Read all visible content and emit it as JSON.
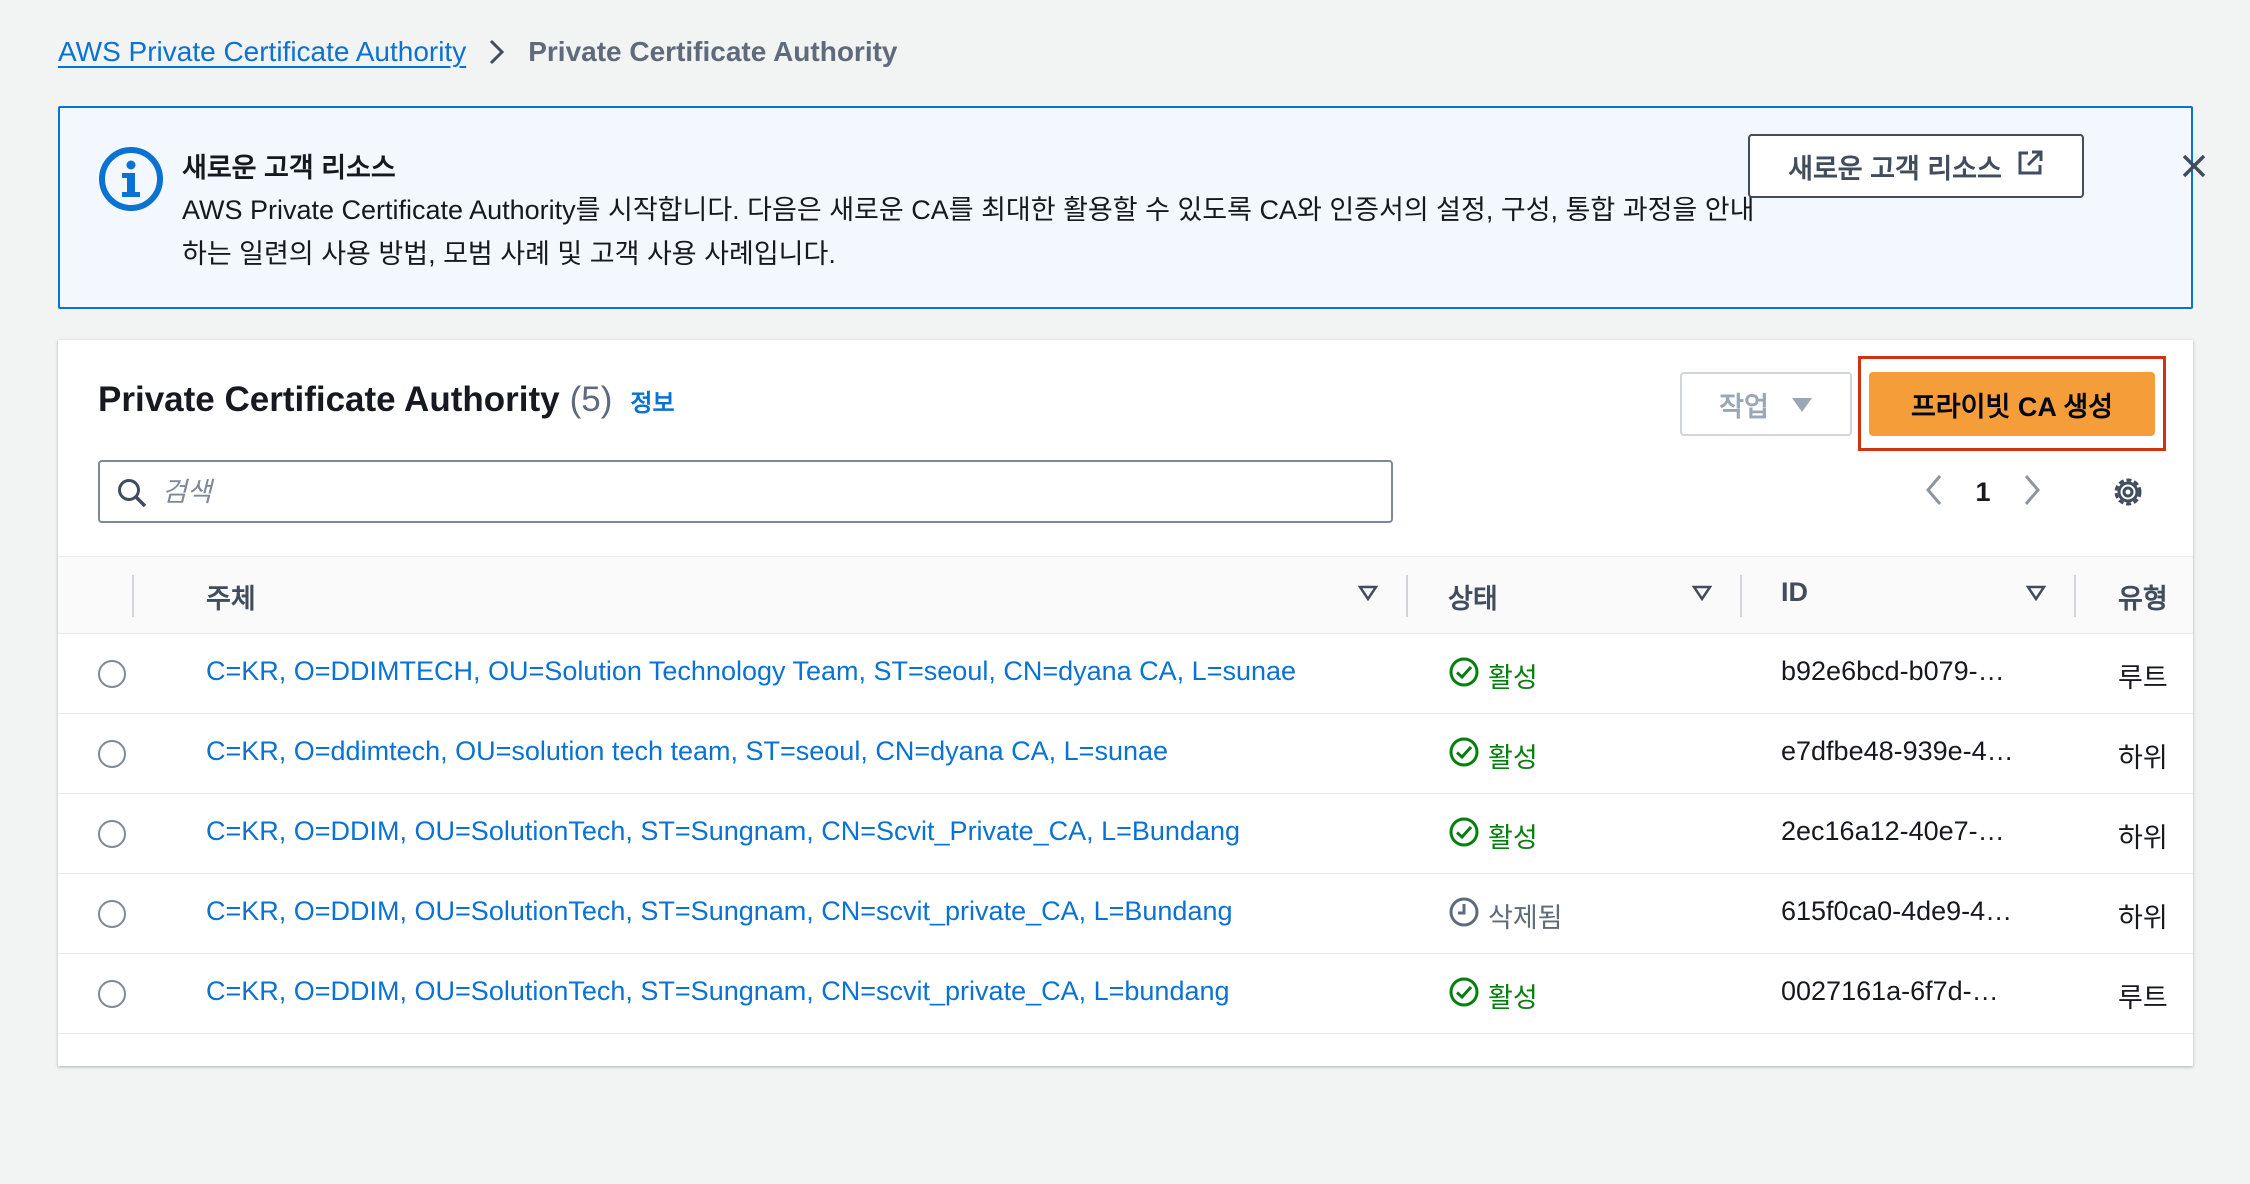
{
  "breadcrumb": {
    "root": "AWS Private Certificate Authority",
    "current": "Private Certificate Authority"
  },
  "info_banner": {
    "title": "새로운 고객 리소스",
    "body": "AWS Private Certificate Authority를 시작합니다. 다음은 새로운 CA를 최대한 활용할 수 있도록 CA와 인증서의 설정, 구성, 통합 과정을 안내하는 일련의 사용 방법, 모범 사례 및 고객 사용 사례입니다.",
    "external_button": "새로운 고객 리소스",
    "icon": "info-icon",
    "accent": "#0972d3"
  },
  "panel": {
    "title": "Private Certificate Authority",
    "count": "(5)",
    "info_link": "정보",
    "actions_label": "작업",
    "create_label": "프라이빗 CA 생성",
    "create_color": "#f59d39",
    "highlight_color": "#d13212",
    "search_placeholder": "검색",
    "page": "1"
  },
  "columns": {
    "subject": "주체",
    "status": "상태",
    "id": "ID",
    "type": "유형"
  },
  "rows": [
    {
      "subject": "C=KR, O=DDIMTECH, OU=Solution Technology Team, ST=seoul, CN=dyana CA, L=sunae",
      "status": "활성",
      "status_kind": "active",
      "id": "b92e6bcd-b079-…",
      "type": "루트"
    },
    {
      "subject": "C=KR, O=ddimtech, OU=solution tech team, ST=seoul, CN=dyana CA, L=sunae",
      "status": "활성",
      "status_kind": "active",
      "id": "e7dfbe48-939e-4…",
      "type": "하위"
    },
    {
      "subject": "C=KR, O=DDIM, OU=SolutionTech, ST=Sungnam, CN=Scvit_Private_CA, L=Bundang",
      "status": "활성",
      "status_kind": "active",
      "id": "2ec16a12-40e7-…",
      "type": "하위"
    },
    {
      "subject": "C=KR, O=DDIM, OU=SolutionTech, ST=Sungnam, CN=scvit_private_CA, L=Bundang",
      "status": "삭제됨",
      "status_kind": "deleted",
      "id": "615f0ca0-4de9-4…",
      "type": "하위"
    },
    {
      "subject": "C=KR, O=DDIM, OU=SolutionTech, ST=Sungnam, CN=scvit_private_CA, L=bundang",
      "status": "활성",
      "status_kind": "active",
      "id": "0027161a-6f7d-…",
      "type": "루트"
    }
  ]
}
